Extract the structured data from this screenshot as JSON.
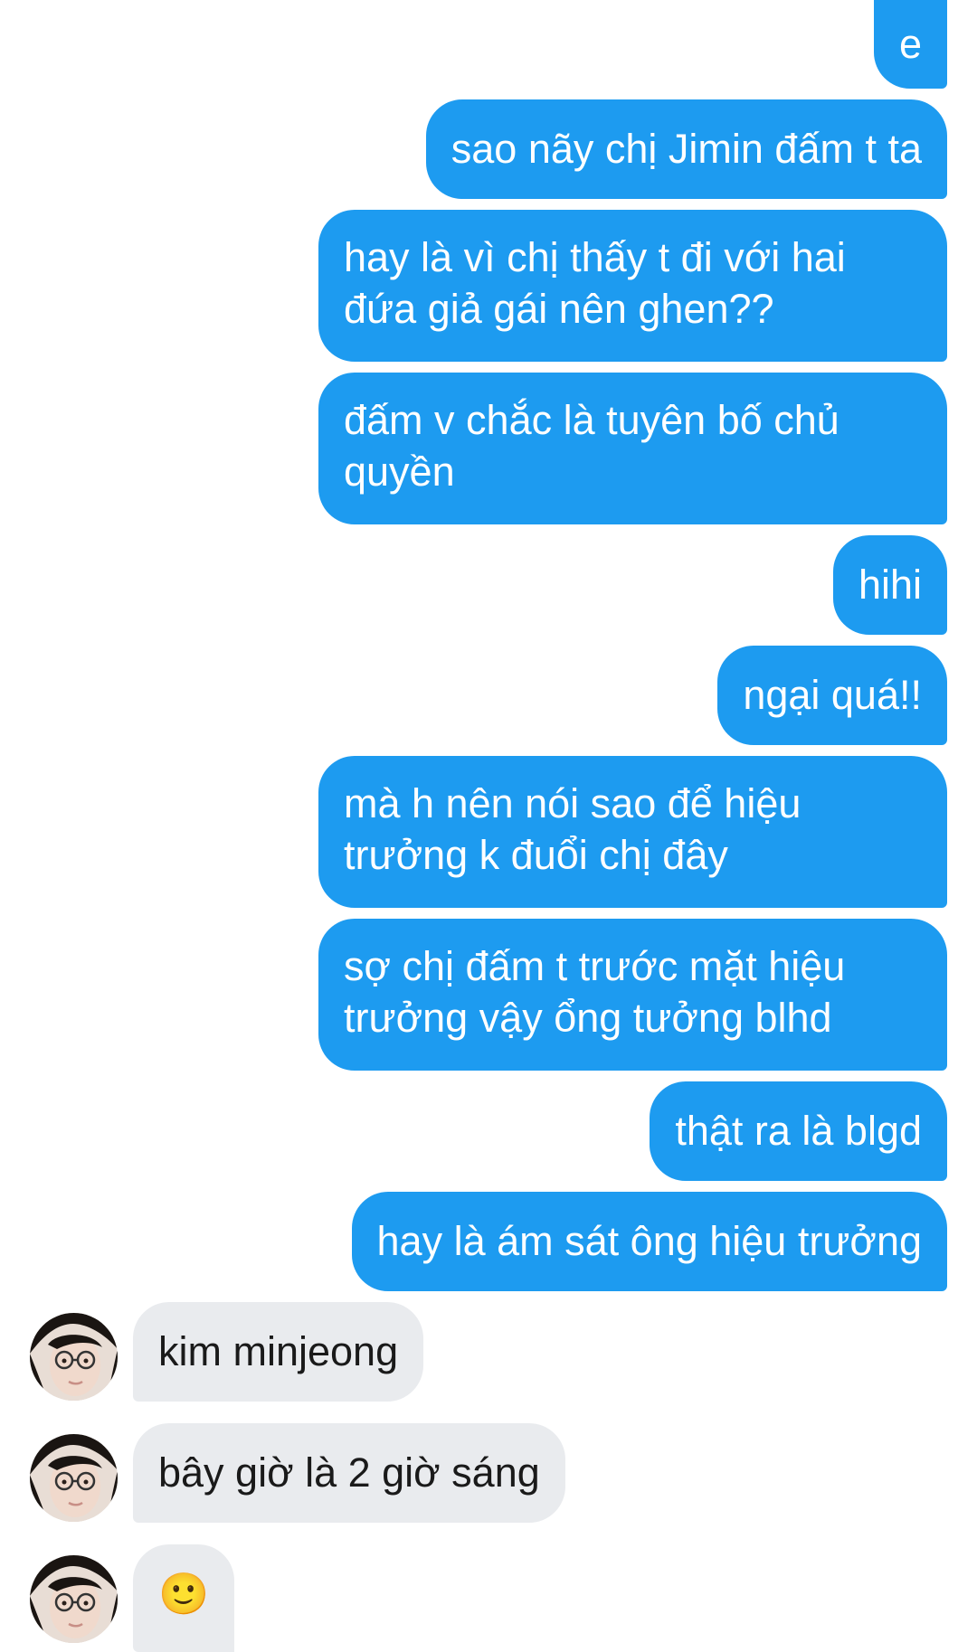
{
  "colors": {
    "outgoing_bubble": "#1d9bf0",
    "incoming_bubble": "#e9ebee",
    "background": "#ffffff"
  },
  "outgoing_messages": [
    {
      "text": "e"
    },
    {
      "text": "sao nãy chị Jimin đấm t ta"
    },
    {
      "text": "hay là vì chị thấy t đi với hai\nđứa giả gái nên ghen??"
    },
    {
      "text": "đấm v chắc là tuyên bố chủ\nquyền"
    },
    {
      "text": "hihi"
    },
    {
      "text": "ngại quá!!"
    },
    {
      "text": "mà h nên nói sao để hiệu\ntrưởng k đuổi chị đây"
    },
    {
      "text": "sợ chị đấm t trước mặt hiệu\ntrưởng vậy ổng tưởng blhd"
    },
    {
      "text": "thật ra là blgd"
    },
    {
      "text": "hay là ám sát ông hiệu trưởng"
    }
  ],
  "incoming_messages": [
    {
      "text": "kim minjeong",
      "avatar": "contact-avatar"
    },
    {
      "text": "bây giờ là 2 giờ sáng",
      "avatar": "contact-avatar"
    },
    {
      "text": "🙂",
      "avatar": "contact-avatar"
    }
  ]
}
